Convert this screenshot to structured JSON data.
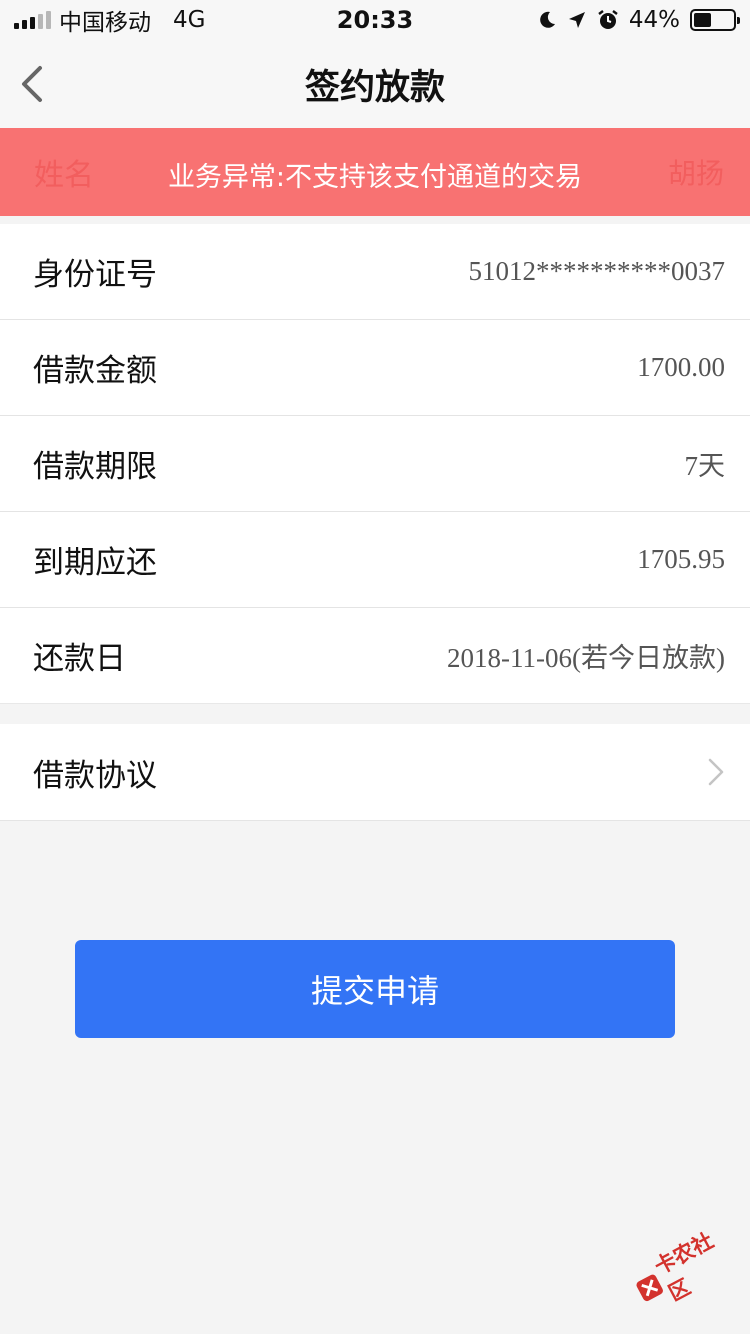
{
  "status_bar": {
    "carrier": "中国移动",
    "network": "4G",
    "time": "20:33",
    "battery": "44%",
    "battery_level": 0.44
  },
  "nav": {
    "title": "签约放款"
  },
  "banner": {
    "message": "业务异常:不支持该支付通道的交易",
    "left_ghost": "姓名",
    "right_ghost": "胡扬",
    "color": "#f87272"
  },
  "details": {
    "rows": [
      {
        "label": "身份证号",
        "value": "51012**********0037"
      },
      {
        "label": "借款金额",
        "value": "1700.00"
      },
      {
        "label": "借款期限",
        "value": "7天"
      },
      {
        "label": "到期应还",
        "value": "1705.95"
      },
      {
        "label": "还款日",
        "value": "2018-11-06(若今日放款)"
      }
    ]
  },
  "agreement": {
    "label": "借款协议"
  },
  "submit": {
    "label": "提交申请",
    "color": "#3374f5"
  },
  "watermark": {
    "text": "卡农社区"
  },
  "icons": {
    "back": "chevron-left-icon",
    "agreement_arrow": "chevron-right-icon",
    "moon": "moon-icon",
    "location": "location-arrow-icon",
    "alarm": "alarm-icon"
  }
}
